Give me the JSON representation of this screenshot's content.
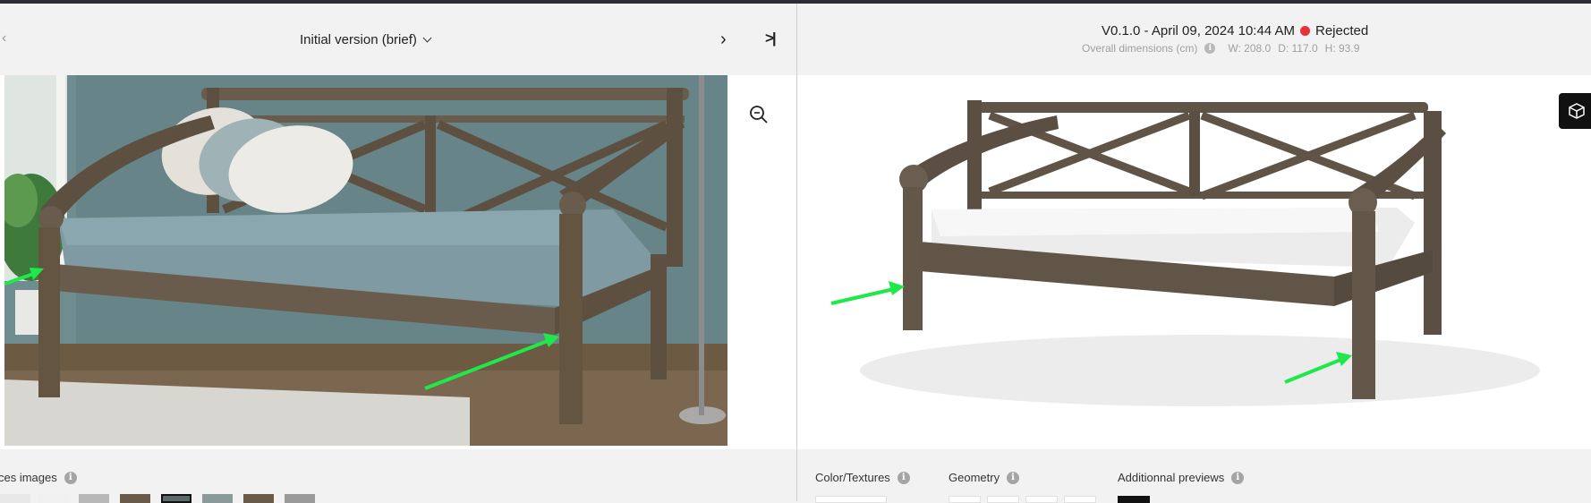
{
  "left": {
    "prev_icon": "chevron-left-icon",
    "version_select": {
      "label": "Initial version (brief)",
      "icon": "chevron-down-icon"
    },
    "next_icon": "chevron-right-icon",
    "last_icon": "skip-to-end-icon",
    "zoom_icon": "zoom-out-icon",
    "references_label": "ces images",
    "thumbnails_count": 8
  },
  "right": {
    "version_info": "V0.1.0 - April 09, 2024 10:44 AM",
    "status": {
      "label": "Rejected",
      "color": "#e8323a"
    },
    "dimensions": {
      "label": "Overall dimensions (cm)",
      "w": "W: 208.0",
      "d": "D: 117.0",
      "h": "H: 93.9"
    },
    "viewer_icon": "3d-cube-icon",
    "tabs": [
      {
        "label": "Color/Textures"
      },
      {
        "label": "Geometry"
      },
      {
        "label": "Additionnal previews"
      }
    ]
  },
  "colors": {
    "accent_arrow": "#1ee84a",
    "header_bar": "#2b2d33",
    "panel_bg": "#f2f2f2"
  }
}
